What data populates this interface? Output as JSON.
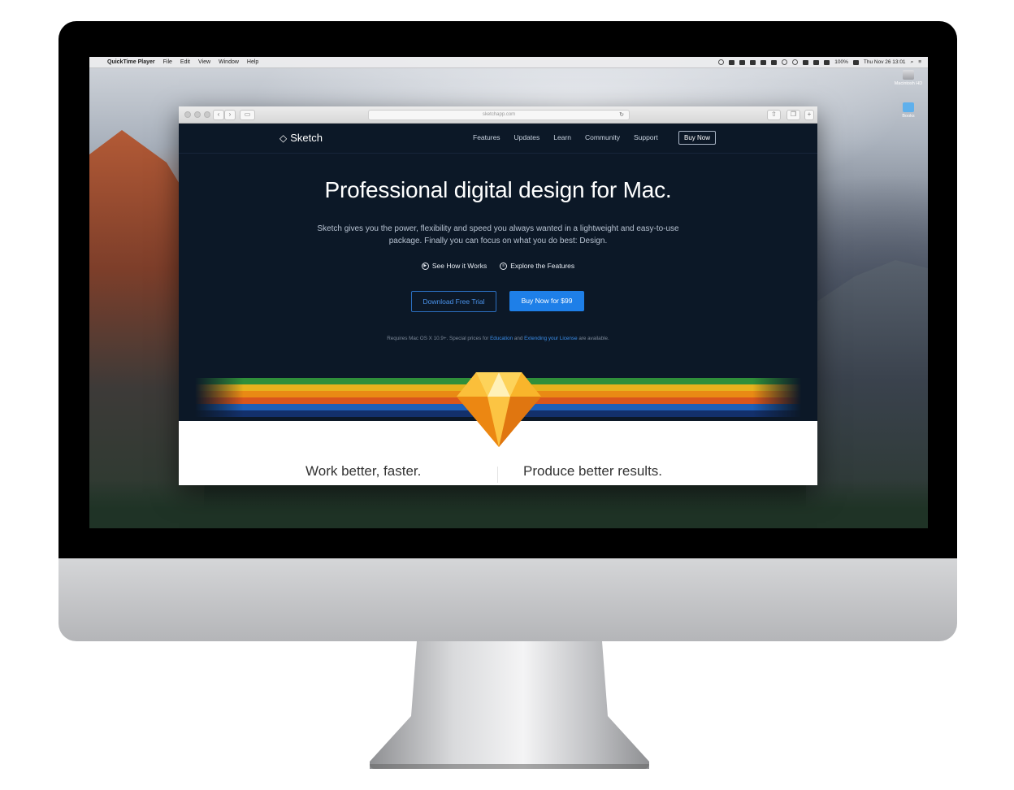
{
  "menubar": {
    "apple_glyph": "",
    "app_name": "QuickTime Player",
    "menus": [
      "File",
      "Edit",
      "View",
      "Window",
      "Help"
    ],
    "battery": "100%",
    "datetime": "Thu Nov 26  13:01"
  },
  "desktop": {
    "icons": [
      {
        "label": "Macintosh HD",
        "icon": "hard-drive-icon"
      },
      {
        "label": "Books",
        "icon": "folder-icon"
      }
    ]
  },
  "safari": {
    "address": "sketchapp.com",
    "back_glyph": "‹",
    "forward_glyph": "›"
  },
  "sketch": {
    "brand": "Sketch",
    "nav": [
      "Features",
      "Updates",
      "Learn",
      "Community",
      "Support"
    ],
    "buy_now": "Buy Now",
    "hero_title": "Professional digital design for Mac.",
    "hero_sub": "Sketch gives you the power, flexibility and speed you always wanted in a lightweight and easy-to-use package. Finally you can focus on what you do best: Design.",
    "link_video": "See How it Works",
    "link_features": "Explore the Features",
    "download_trial": "Download Free Trial",
    "buy_price": "Buy Now for $99",
    "req_pre": "Requires Mac OS X 10.9+. Special prices for ",
    "req_edu": "Education",
    "req_and": " and ",
    "req_license": "Extending your License",
    "req_post": " are available.",
    "col_left": "Work better, faster.",
    "col_right": "Produce better results.",
    "stripe_colors": [
      "#2f8f3a",
      "#e6b21d",
      "#e98a14",
      "#d9561c",
      "#1d5fb8",
      "#13306b"
    ]
  }
}
